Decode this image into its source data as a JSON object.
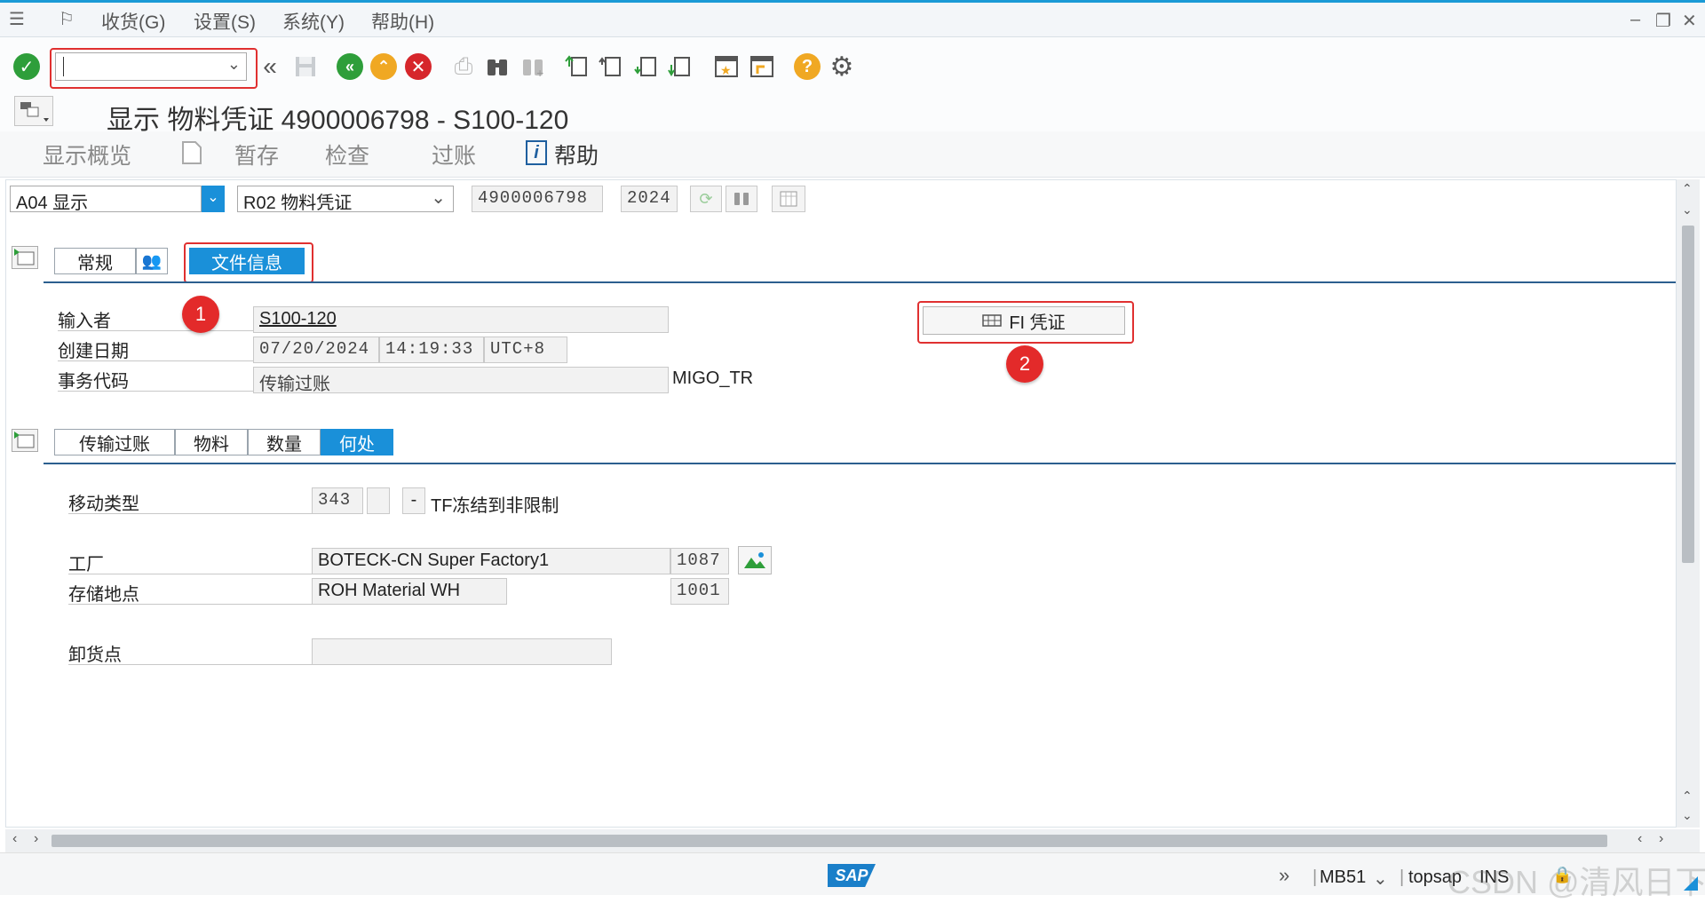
{
  "menu": {
    "items": [
      "收货(G)",
      "设置(S)",
      "系统(Y)",
      "帮助(H)"
    ]
  },
  "toolbar": {
    "command_field_value": ""
  },
  "title": "显示 物料凭证 4900006798 - S100-120",
  "app_toolbar": {
    "overview": "显示概览",
    "hold": "暂存",
    "check": "检查",
    "post": "过账",
    "help": "帮助"
  },
  "header_row": {
    "action": "A04 显示",
    "reference": "R02 物料凭证",
    "doc_number": "4900006798",
    "year": "2024"
  },
  "header_tabs": [
    "常规",
    "文件信息"
  ],
  "doc_info": {
    "entered_by_label": "输入者",
    "entered_by": "S100-120",
    "created_label": "创建日期",
    "created_date": "07/20/2024",
    "created_time": "14:19:33",
    "timezone": "UTC+8",
    "tcode_label": "事务代码",
    "tcode_desc": "传输过账",
    "tcode": "MIGO_TR",
    "fi_button": "FI 凭证"
  },
  "item_tabs": [
    "传输过账",
    "物料",
    "数量",
    "何处"
  ],
  "where": {
    "movement_type_label": "移动类型",
    "movement_type": "343",
    "movement_sign": "-",
    "movement_desc": "TF冻结到非限制",
    "plant_label": "工厂",
    "plant_name": "BOTECK-CN Super Factory1",
    "plant_code": "1087",
    "sloc_label": "存储地点",
    "sloc_name": "ROH Material WH",
    "sloc_code": "1001",
    "unloading_label": "卸货点",
    "unloading_value": ""
  },
  "annotations": [
    "1",
    "2"
  ],
  "status": {
    "tcode": "MB51",
    "system": "topsap",
    "mode": "INS",
    "watermark": "CSDN @清风日下"
  },
  "colors": {
    "accent": "#1a90d9",
    "annotation_red": "#e32a2a",
    "ok_green": "#2e9e3a",
    "cancel_red": "#d6262b",
    "help_orange": "#f0a823"
  }
}
